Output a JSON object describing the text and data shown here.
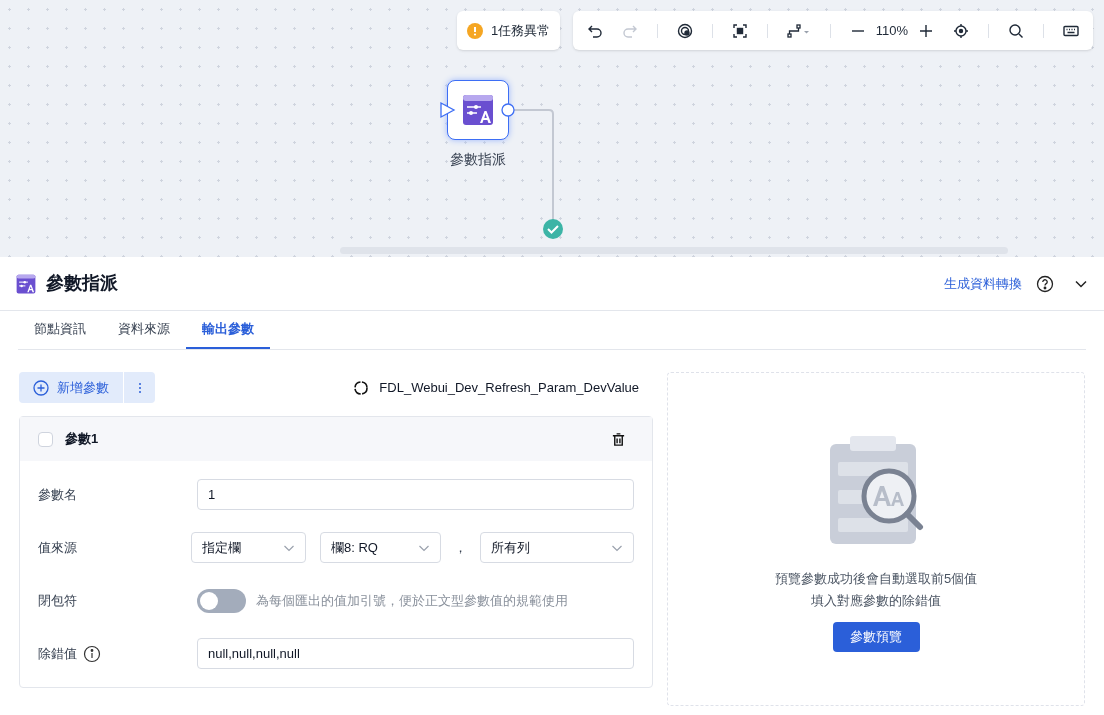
{
  "canvas": {
    "alert": "1任務異常",
    "zoom": "110%",
    "node": {
      "label": "參數指派"
    }
  },
  "panel": {
    "title": "參數指派",
    "link": "生成資料轉換",
    "tabs": [
      {
        "label": "節點資訊",
        "selected": false
      },
      {
        "label": "資料來源",
        "selected": false
      },
      {
        "label": "輸出參數",
        "selected": true
      }
    ],
    "add_button": "新增參數",
    "refresh_label": "FDL_Webui_Dev_Refresh_Param_DevValue",
    "param": {
      "name": "參數1",
      "checked": false,
      "fields": [
        {
          "kind": "input",
          "label": "參數名",
          "value": "1"
        },
        {
          "kind": "selects",
          "label": "值來源",
          "options": [
            "指定欄",
            "欄8: RQ"
          ],
          "separator": "，",
          "last": "所有列"
        },
        {
          "kind": "toggle",
          "label": "閉包符",
          "on": false,
          "hint": "為每個匯出的值加引號，便於正文型參數值的規範使用"
        },
        {
          "kind": "input",
          "label": "除錯值",
          "info": true,
          "value": "null,null,null,null"
        }
      ]
    },
    "preview": {
      "lines": [
        "預覽參數成功後會自動選取前5個值",
        "填入對應參數的除錯值"
      ],
      "button": "參數預覽"
    }
  }
}
